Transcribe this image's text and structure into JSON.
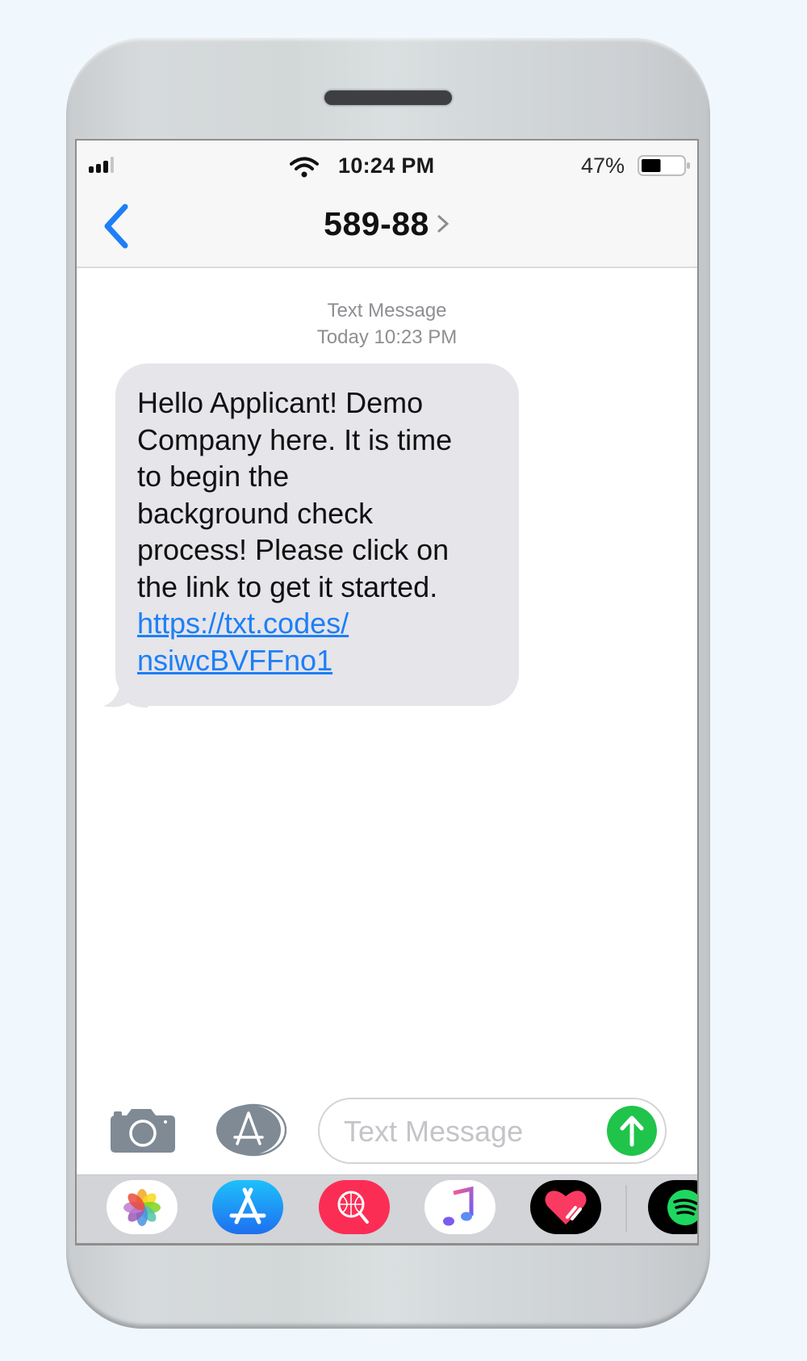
{
  "status_bar": {
    "time": "10:24 PM",
    "battery_percent": "47%",
    "battery_level": 0.47,
    "signal_bars": 3,
    "signal_bars_total": 4
  },
  "nav": {
    "back_icon": "chevron-left-icon",
    "title": "589-88",
    "title_chevron_icon": "chevron-right-icon"
  },
  "conversation": {
    "service_label": "Text Message",
    "timestamp": "Today 10:23 PM",
    "messages": [
      {
        "direction": "incoming",
        "lines": [
          "Hello Applicant! Demo",
          "Company here. It is time",
          "to begin the",
          "background check",
          "process! Please click on",
          "the link to get it started."
        ],
        "link_lines": [
          "https://txt.codes/",
          "nsiwcBVFFno1"
        ]
      }
    ]
  },
  "composer": {
    "camera_icon": "camera-icon",
    "apps_icon": "app-store-icon",
    "placeholder": "Text Message",
    "value": "",
    "send_icon": "arrow-up-icon"
  },
  "dock": {
    "apps": [
      {
        "name": "Photos",
        "icon": "photos-icon"
      },
      {
        "name": "App Store",
        "icon": "app-store-icon"
      },
      {
        "name": "Search Images",
        "icon": "globe-search-icon"
      },
      {
        "name": "Music",
        "icon": "music-note-icon"
      },
      {
        "name": "Digital Touch",
        "icon": "heart-icon"
      },
      {
        "name": "Spotify",
        "icon": "spotify-icon"
      }
    ]
  },
  "colors": {
    "accent_blue": "#1d7ff7",
    "bubble_gray": "#e5e5ea",
    "send_green": "#20c44a",
    "meta_gray": "#8e8e93"
  }
}
